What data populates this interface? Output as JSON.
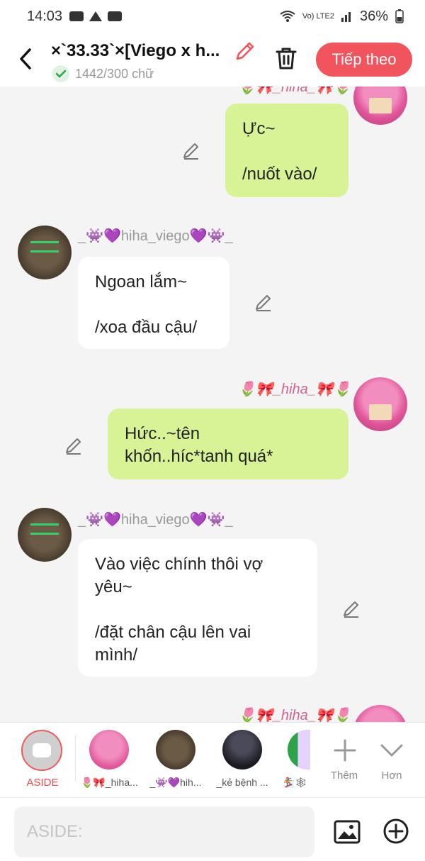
{
  "status": {
    "time": "14:03",
    "battery": "36%",
    "network": "Vo) LTE2"
  },
  "header": {
    "title": "×`33.33`×[Viego x h...",
    "word_count": "1442/300 chữ",
    "next_label": "Tiếp theo"
  },
  "names": {
    "pink": "🌷🎀_hiha_🎀🌷",
    "viego": "_👾💜hiha_viego💜👾_"
  },
  "messages": [
    {
      "text": "Ực~\n\n/nuốt vào/"
    },
    {
      "text": "Ngoan lắm~\n\n/xoa đầu cậu/"
    },
    {
      "text": "Hức..~tên\nkhốn..híc*tanh quá*"
    },
    {
      "text": "Vào việc chính thôi vợ\nyêu~\n\n/đặt chân cậu lên vai\nmình/"
    }
  ],
  "character_bar": {
    "aside_label": "ASIDE",
    "characters": [
      {
        "label": "🌷🎀_hiha..."
      },
      {
        "label": "_👾💜hih..."
      },
      {
        "label": "_kẻ bệnh ..."
      },
      {
        "label": "🏂🕸"
      }
    ],
    "add_label": "Thêm",
    "more_label": "Hơn"
  },
  "composer": {
    "placeholder": "ASIDE:"
  },
  "colors": {
    "accent": "#f1545d",
    "bubble_green": "#d8f296",
    "bubble_white": "#ffffff"
  }
}
